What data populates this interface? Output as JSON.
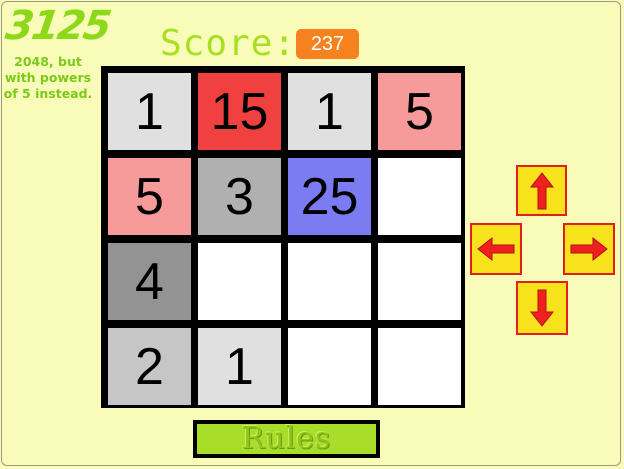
{
  "title": "3125",
  "subtitle": "2048, but with powers of 5 instead.",
  "score": {
    "label": "Score:",
    "value": "237"
  },
  "board": [
    [
      {
        "value": "1",
        "color": "#e0e0e0"
      },
      {
        "value": "15",
        "color": "#f04040"
      },
      {
        "value": "1",
        "color": "#e0e0e0"
      },
      {
        "value": "5",
        "color": "#f79a9a"
      }
    ],
    [
      {
        "value": "5",
        "color": "#f79a9a"
      },
      {
        "value": "3",
        "color": "#b0b0b0"
      },
      {
        "value": "25",
        "color": "#7b7bf2"
      },
      {
        "value": "",
        "color": "#ffffff"
      }
    ],
    [
      {
        "value": "4",
        "color": "#939393"
      },
      {
        "value": "",
        "color": "#ffffff"
      },
      {
        "value": "",
        "color": "#ffffff"
      },
      {
        "value": "",
        "color": "#ffffff"
      }
    ],
    [
      {
        "value": "2",
        "color": "#c6c6c6"
      },
      {
        "value": "1",
        "color": "#e0e0e0"
      },
      {
        "value": "",
        "color": "#ffffff"
      },
      {
        "value": "",
        "color": "#ffffff"
      }
    ]
  ],
  "controls": {
    "up": {
      "icon": "arrow-up-icon"
    },
    "left": {
      "icon": "arrow-left-icon"
    },
    "right": {
      "icon": "arrow-right-icon"
    },
    "down": {
      "icon": "arrow-down-icon"
    },
    "arrow_color": "#f02020",
    "button_color": "#f8e21b"
  },
  "rules_label": "Rules"
}
